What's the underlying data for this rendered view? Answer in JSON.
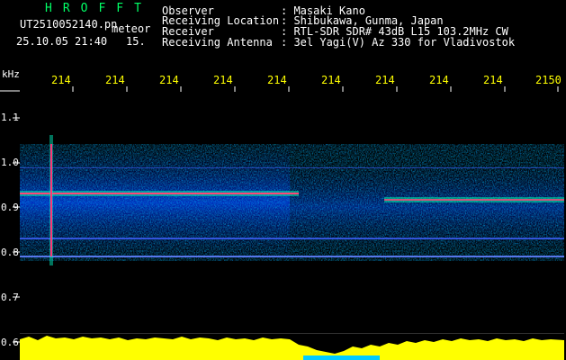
{
  "header": {
    "logo": "HROFFT",
    "filename": "UT2510052140.pn",
    "mode": "meteor",
    "timestamp": "25.10.05 21:40",
    "interval": "15.",
    "fields": [
      {
        "label": "Observer",
        "value": ": Masaki Kano"
      },
      {
        "label": "Receiving Location",
        "value": ": Shibukawa, Gunma, Japan"
      },
      {
        "label": "Receiver",
        "value": ": RTL-SDR SDR# 43dB L15 103.2MHz CW"
      },
      {
        "label": "Receiving Antenna",
        "value": ": 3el Yagi(V) Az 330 for Vladivostok"
      }
    ]
  },
  "x_axis": {
    "ticks": [
      "214",
      "214",
      "214",
      "214",
      "214",
      "214",
      "214",
      "214",
      "214",
      "2150"
    ]
  },
  "y_axis": {
    "unit": "kHz",
    "ticks": [
      "1.1",
      "1.0",
      "0.9",
      "0.8",
      "0.7",
      "0.6"
    ]
  },
  "colors": {
    "background": "#000000",
    "spectro_bg": "#000060",
    "signal_line": "#ff3366",
    "histogram": "#ffff00",
    "tick_text": "#ffff00",
    "logo_text": "#00ff66"
  }
}
